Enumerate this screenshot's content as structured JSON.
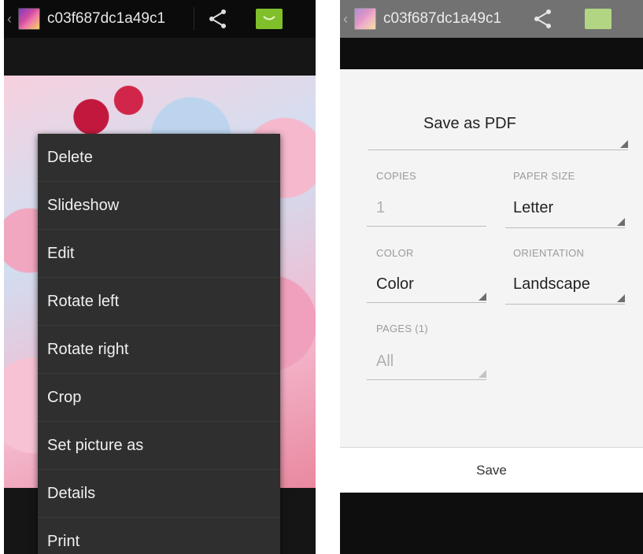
{
  "left": {
    "actionbar": {
      "back_glyph": "‹",
      "title": "c03f687dc1a49c1",
      "share_icon": "share-icon",
      "message_icon": "message-icon"
    },
    "menu": {
      "items": [
        {
          "label": "Delete"
        },
        {
          "label": "Slideshow"
        },
        {
          "label": "Edit"
        },
        {
          "label": "Rotate left"
        },
        {
          "label": "Rotate right"
        },
        {
          "label": "Crop"
        },
        {
          "label": "Set picture as"
        },
        {
          "label": "Details"
        },
        {
          "label": "Print"
        }
      ]
    }
  },
  "right": {
    "actionbar": {
      "back_glyph": "‹",
      "title": "c03f687dc1a49c1"
    },
    "printer": {
      "destination": "Save as PDF"
    },
    "copies": {
      "label": "COPIES",
      "value": "1"
    },
    "paper_size": {
      "label": "PAPER SIZE",
      "value": "Letter"
    },
    "color": {
      "label": "COLOR",
      "value": "Color"
    },
    "orientation": {
      "label": "ORIENTATION",
      "value": "Landscape"
    },
    "pages": {
      "label": "PAGES (1)",
      "value": "All"
    },
    "save_label": "Save"
  },
  "colors": {
    "accent_green": "#7fbf2a",
    "menu_bg": "#2f2f2f",
    "dialog_bg": "#f4f4f4"
  }
}
